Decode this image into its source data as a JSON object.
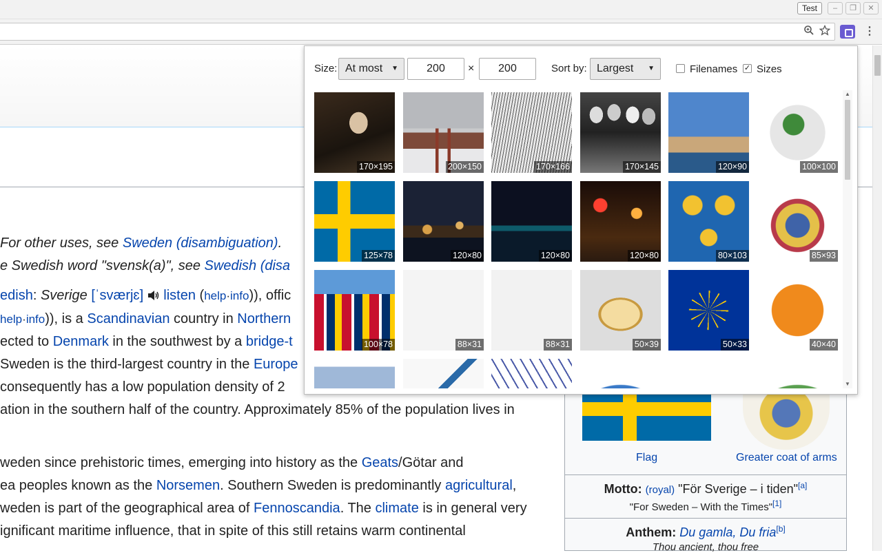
{
  "window": {
    "profile_label": "Test",
    "minimize_glyph": "–",
    "restore_glyph": "❐",
    "close_glyph": "✕"
  },
  "toolbar": {
    "zoom_icon": "zoom-icon",
    "star_icon": "star-icon",
    "menu_glyph": "⋮"
  },
  "article": {
    "hatnote1_pre": "For other uses, see ",
    "hatnote1_link": "Sweden (disambiguation)",
    "hatnote1_post": ".",
    "hatnote2_pre": "e Swedish word \"svensk(a)\", see ",
    "hatnote2_link": "Swedish (disa",
    "p1_l1_a": "edish",
    "p1_l1_b": ": ",
    "p1_l1_c": "Sverige",
    "p1_l1_ipa": "[ˈsværjɛ]",
    "p1_l1_listen": "listen",
    "p1_l1_help": "help",
    "p1_l1_info": "info",
    "p1_l1_tail": ")), offic",
    "p1_l2_a": "help",
    "p1_l2_b": "info",
    "p1_l2_c": ")), is a ",
    "p1_l2_link1": "Scandinavian",
    "p1_l2_d": " country in ",
    "p1_l2_link2": "Northern",
    "p1_l3_a": "ected to ",
    "p1_l3_link1": "Denmark",
    "p1_l3_b": " in the southwest by a ",
    "p1_l3_link2": "bridge-t",
    "p1_l4_a": "Sweden is the third-largest country in the ",
    "p1_l4_link": "Europe",
    "p1_l5": " consequently has a low population density of 2",
    "p1_l6": "ation in the southern half of the country. Approximately 85% of the population lives in",
    "p2_l1_a": "weden since prehistoric times, emerging into history as the ",
    "p2_l1_link": "Geats",
    "p2_l1_b": "/Götar and",
    "p2_l2_a": "ea peoples known as the ",
    "p2_l2_link1": "Norsemen",
    "p2_l2_b": ". Southern Sweden is predominantly ",
    "p2_l2_link2": "agricultural",
    "p2_l2_c": ",",
    "p2_l3_a": "weden is part of the geographical area of ",
    "p2_l3_link1": "Fennoscandia",
    "p2_l3_b": ". The ",
    "p2_l3_link2": "climate",
    "p2_l3_c": " is in general very",
    "p2_l4": "ignificant maritime influence, that in spite of this still retains warm continental"
  },
  "infobox": {
    "flag_caption": "Flag",
    "coa_caption": "Greater coat of arms",
    "motto_label": "Motto:",
    "motto_royal": "(royal)",
    "motto_text": "\"För Sverige – i tiden\"",
    "motto_ref": "[a]",
    "motto_translation": "\"For Sweden – With the Times\"",
    "motto_translation_ref": "[1]",
    "anthem_label": "Anthem:",
    "anthem_link": "Du gamla, Du fria",
    "anthem_ref": "[b]",
    "anthem_translation": "Thou ancient, thou free"
  },
  "popup": {
    "size_label": "Size:",
    "size_mode": "At most",
    "width_value": "200",
    "times": "×",
    "height_value": "200",
    "sort_label": "Sort by:",
    "sort_value": "Largest",
    "filenames_label": "Filenames",
    "filenames_checked": false,
    "sizes_label": "Sizes",
    "sizes_checked": true,
    "check_glyph": "✓",
    "images": [
      {
        "size": "170×195",
        "icon": "portrait-painting"
      },
      {
        "size": "200×150",
        "icon": "cathedral-winter"
      },
      {
        "size": "170×166",
        "icon": "engraving-interior"
      },
      {
        "size": "170×145",
        "icon": "band-photo"
      },
      {
        "size": "120×90",
        "icon": "harbor-ship"
      },
      {
        "size": "100×100",
        "icon": "europe-globe"
      },
      {
        "size": "125×78",
        "icon": "swedish-flag"
      },
      {
        "size": "120×80",
        "icon": "night-harbor"
      },
      {
        "size": "120×80",
        "icon": "night-coast"
      },
      {
        "size": "120×80",
        "icon": "night-street"
      },
      {
        "size": "80×103",
        "icon": "three-crowns"
      },
      {
        "size": "85×93",
        "icon": "coat-of-arms"
      },
      {
        "size": "100×78",
        "icon": "nordic-flags"
      },
      {
        "size": "88×31",
        "icon": "powered-by-mediawiki"
      },
      {
        "size": "88×31",
        "icon": "wikimedia-project"
      },
      {
        "size": "50×39",
        "icon": "question-book"
      },
      {
        "size": "50×33",
        "icon": "eu-flag"
      },
      {
        "size": "40×40",
        "icon": "question-circle"
      },
      {
        "size": "",
        "icon": "blue-box"
      },
      {
        "size": "",
        "icon": "mountains"
      },
      {
        "size": "",
        "icon": "symbols"
      },
      {
        "size": "",
        "icon": "globe-blue"
      },
      {
        "size": "",
        "icon": "brain-blue"
      },
      {
        "size": "",
        "icon": "globe-green"
      }
    ]
  }
}
